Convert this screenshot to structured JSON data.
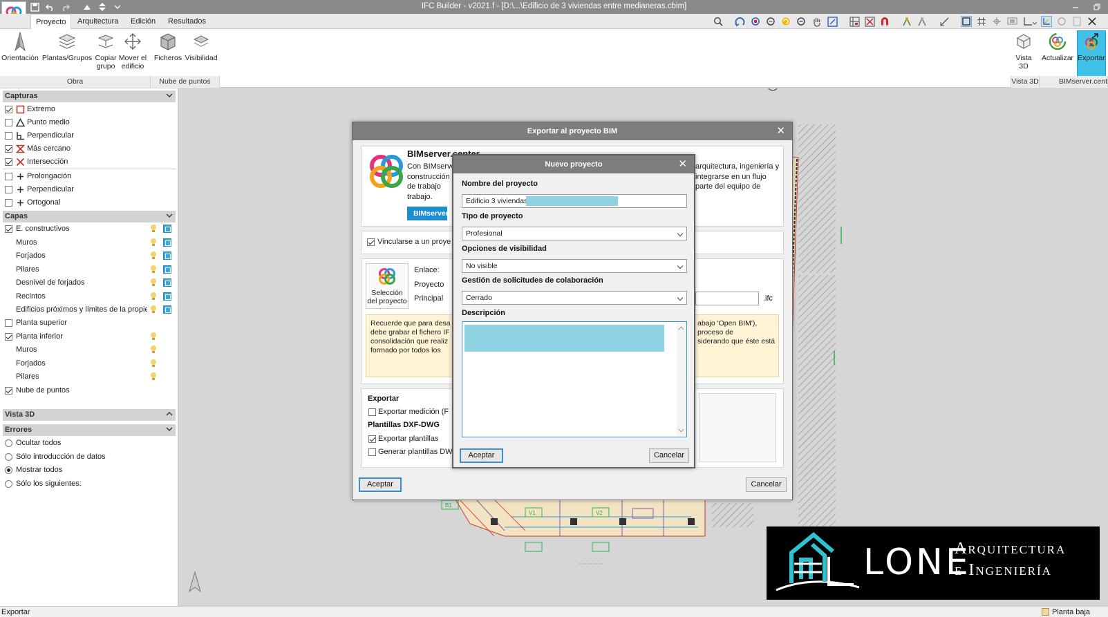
{
  "window": {
    "title": "IFC Builder - v2021.f - [D:\\...\\Edificio de 3 viviendas entre medianeras.cbim]"
  },
  "menu": {
    "tabs": [
      "Proyecto",
      "Arquitectura",
      "Edición",
      "Resultados"
    ]
  },
  "ribbon": {
    "buttons": [
      {
        "label": "Orientación",
        "icon": "north-arrow-icon"
      },
      {
        "label": "Plantas/Grupos",
        "icon": "floors-icon"
      },
      {
        "label": "Copiar grupo",
        "icon": "copy-group-icon"
      },
      {
        "label": "Mover el edificio",
        "icon": "move-icon"
      },
      {
        "label": "Ficheros",
        "icon": "point-cloud-files-icon"
      },
      {
        "label": "Visibilidad",
        "icon": "visibility-icon"
      },
      {
        "label": "Vista 3D",
        "icon": "cube-icon"
      },
      {
        "label": "Actualizar",
        "icon": "update-icon"
      },
      {
        "label": "Exportar",
        "icon": "export-icon"
      }
    ],
    "groups": [
      "Obra",
      "Nube de puntos",
      "Vista 3D",
      "BIMserver.cent"
    ]
  },
  "left_panel": {
    "capturas": {
      "title": "Capturas",
      "items": [
        {
          "label": "Extremo",
          "checked": true
        },
        {
          "label": "Punto medio",
          "checked": false
        },
        {
          "label": "Perpendicular",
          "checked": false
        },
        {
          "label": "Más cercano",
          "checked": true
        },
        {
          "label": "Intersección",
          "checked": true
        },
        {
          "label": "Prolongación",
          "checked": false
        },
        {
          "label": "Perpendicular",
          "checked": false
        },
        {
          "label": "Ortogonal",
          "checked": false
        }
      ]
    },
    "capas": {
      "title": "Capas",
      "items": [
        {
          "label": "E. constructivos",
          "checked": true
        },
        {
          "label": "Muros"
        },
        {
          "label": "Forjados"
        },
        {
          "label": "Pilares"
        },
        {
          "label": "Desnivel de forjados"
        },
        {
          "label": "Recintos"
        },
        {
          "label": "Edificios próximos y límites de la propiedad"
        },
        {
          "label": "Planta superior",
          "checked": false
        },
        {
          "label": "Planta inferior",
          "checked": true
        },
        {
          "label": "Muros"
        },
        {
          "label": "Forjados"
        },
        {
          "label": "Pilares"
        },
        {
          "label": "Nube de puntos",
          "checked": true
        }
      ]
    },
    "vista3d": {
      "title": "Vista 3D"
    },
    "errores": {
      "title": "Errores",
      "items": [
        "Ocultar todos",
        "Sólo introducción de datos",
        "Mostrar todos",
        "Sólo los siguientes:"
      ],
      "selected": 2
    }
  },
  "status": {
    "left": "Exportar",
    "right": "Planta baja"
  },
  "export_dialog": {
    "title": "Exportar al proyecto BIM",
    "bimserver_title": "BIMserver.center",
    "intro_left": [
      "Con BIMserver",
      "construcción",
      "de trabajo",
      "trabajo."
    ],
    "intro_right": [
      "arquitectura, ingeniería y",
      "integrarse en un flujo",
      "parte del equipo de"
    ],
    "bimserver_button": "BIMserver",
    "link_checkbox": "Vincularse a un proye",
    "project_selection": "Selección del proyecto",
    "fields": [
      "Enlace:",
      "Proyecto",
      "Principal"
    ],
    "ifc_ext": ".ifc",
    "note_left": [
      "Recuerde que para desa",
      "debe grabar el fichero IF",
      "consolidación que realiz",
      "formado por todos los"
    ],
    "note_right": [
      "abajo 'Open BIM'),",
      "proceso de",
      "siderando que éste está"
    ],
    "export_heading": "Exportar",
    "export_measure": "Exportar medición (F",
    "dxf_heading": "Plantillas DXF-DWG",
    "export_templates": "Exportar plantillas",
    "generate_templates": "Generar plantillas DWG",
    "accept": "Aceptar",
    "cancel": "Cancelar"
  },
  "new_project_dialog": {
    "title": "Nuevo proyecto",
    "name_label": "Nombre del proyecto",
    "name_value": "Edificio 3 viviendas",
    "type_label": "Tipo de proyecto",
    "type_value": "Profesional",
    "visibility_label": "Opciones de visibilidad",
    "visibility_value": "No visible",
    "collab_label": "Gestión de solicitudes de colaboración",
    "collab_value": "Cerrado",
    "description_label": "Descripción",
    "accept": "Aceptar",
    "cancel": "Cancelar"
  },
  "canvas_labels": {
    "b1": "B1",
    "v1": "V1",
    "v2": "V2"
  },
  "logo": {
    "brand": "LONE",
    "line1": "Arquitectura",
    "line2": "e Ingeniería"
  },
  "colors": {
    "accent": "#3b8fd3",
    "highlight": "#8fd3e3",
    "note_bg": "#fff4d6",
    "export_active": "#3fc1e8",
    "logo_teal": "#2fc3cf"
  }
}
